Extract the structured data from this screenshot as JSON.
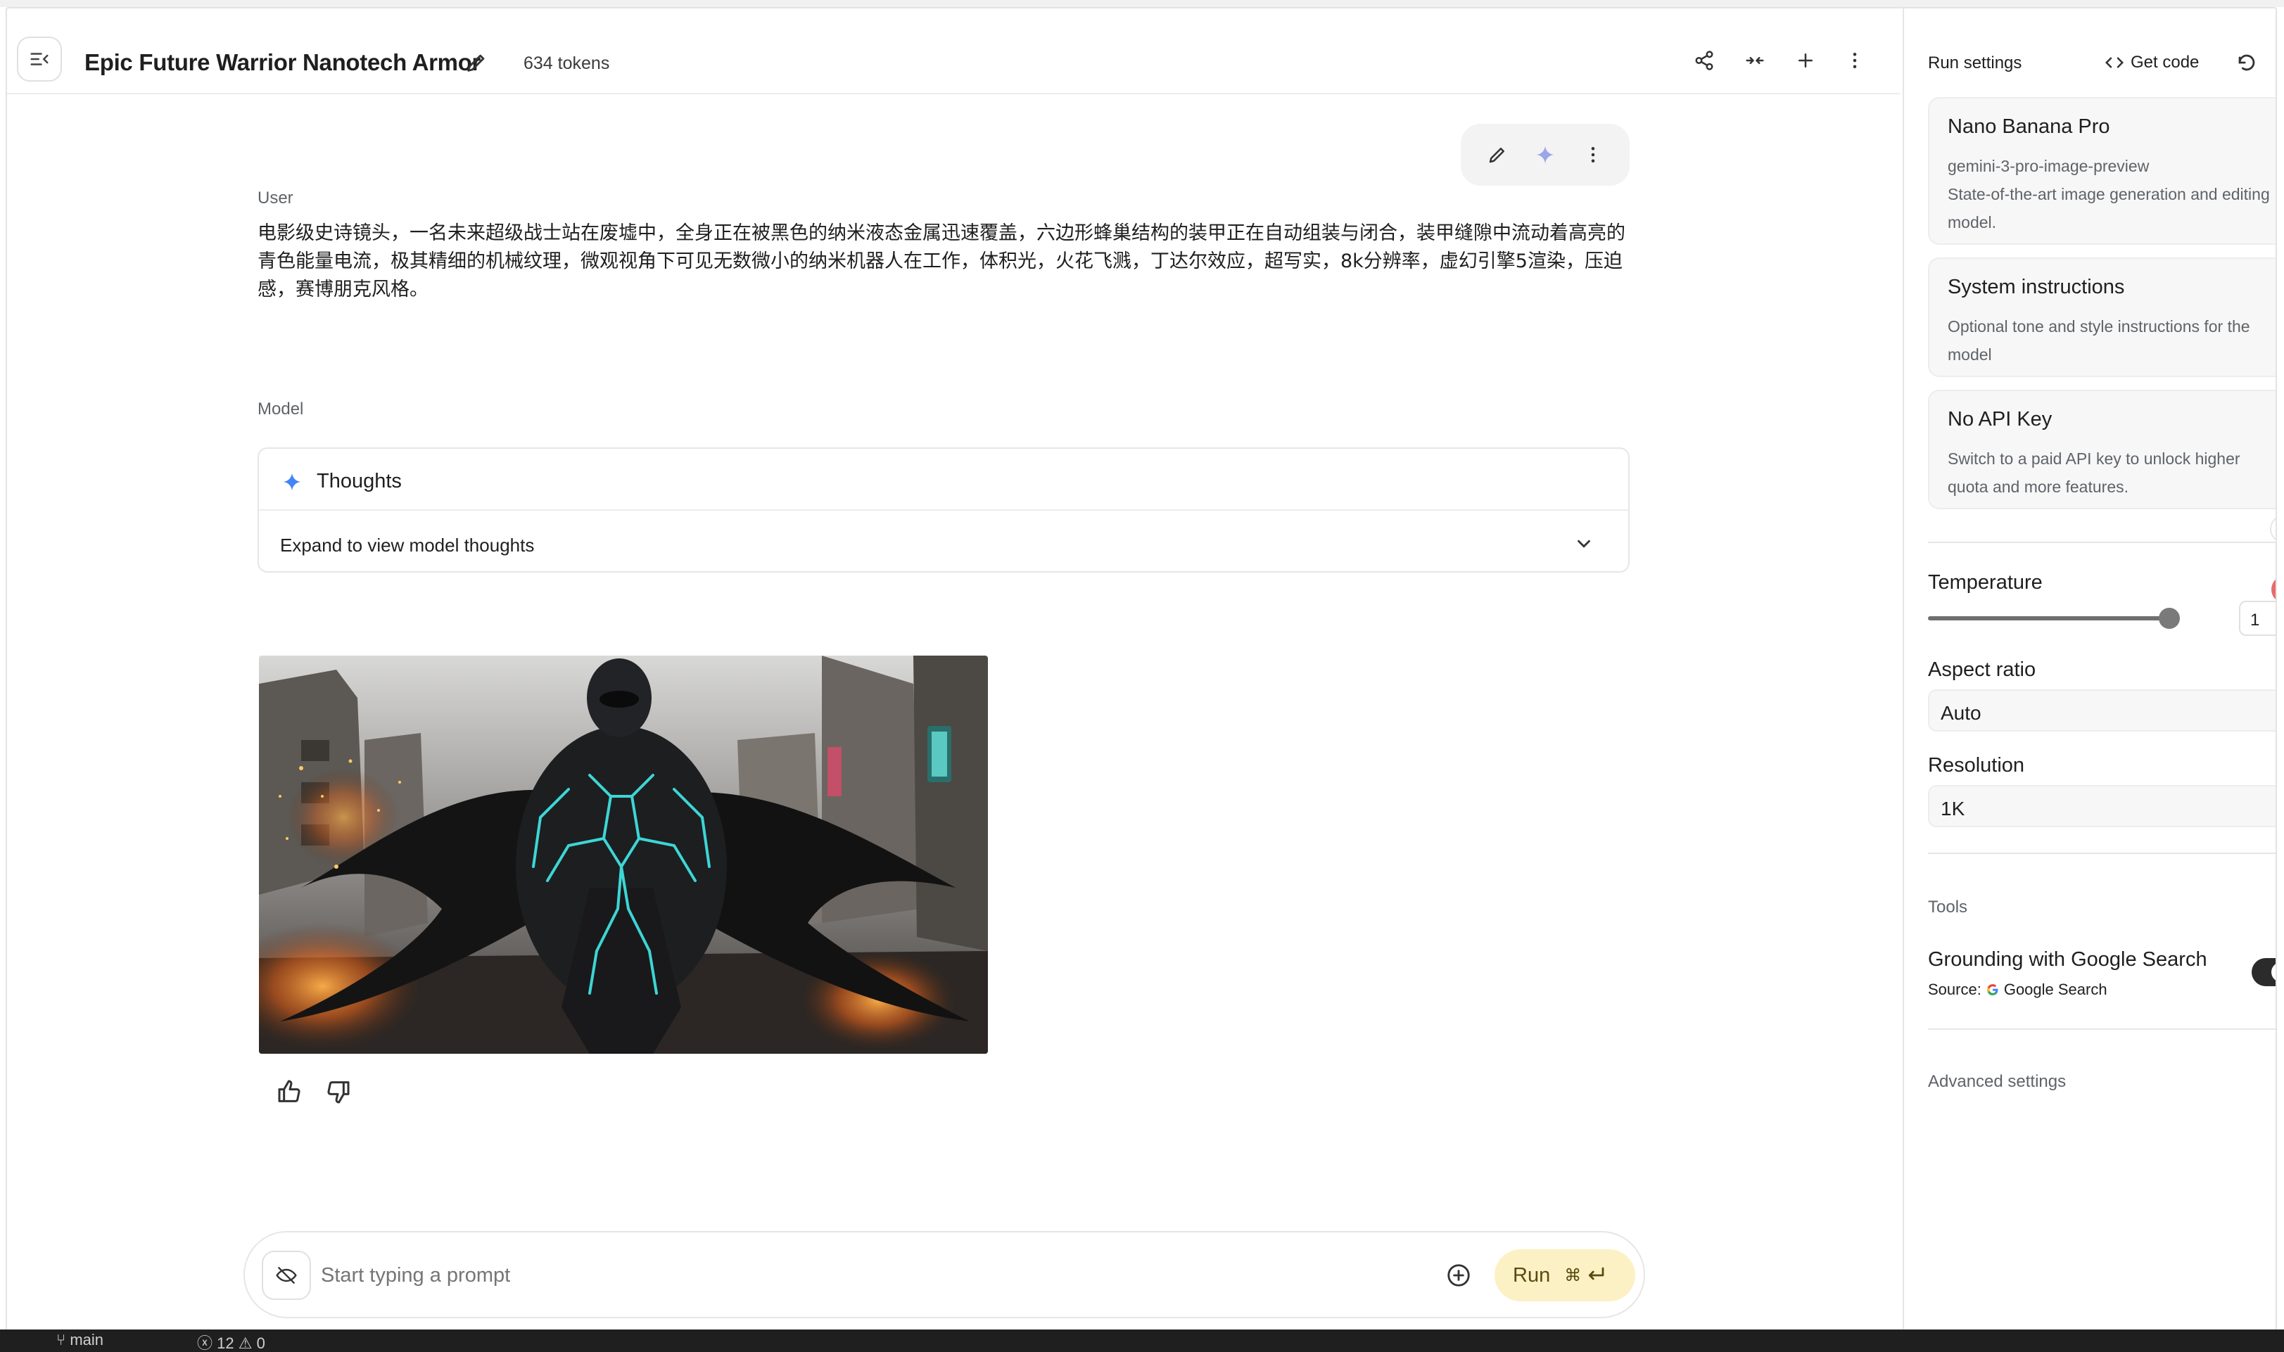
{
  "header": {
    "title": "Epic Future Warrior Nanotech Armor",
    "tokens": "634 tokens"
  },
  "conversation": {
    "user_label": "User",
    "user_text": "电影级史诗镜头，一名未来超级战士站在废墟中，全身正在被黑色的纳米液态金属迅速覆盖，六边形蜂巢结构的装甲正在自动组装与闭合，装甲缝隙中流动着高亮的青色能量电流，极其精细的机械纹理，微观视角下可见无数微小的纳米机器人在工作，体积光，火花飞溅，丁达尔效应，超写实，8k分辨率，虚幻引擎5渲染，压迫感，赛博朋克风格。",
    "model_label": "Model",
    "thoughts_title": "Thoughts",
    "thoughts_expand": "Expand to view model thoughts"
  },
  "prompt": {
    "placeholder": "Start typing a prompt",
    "run_label": "Run",
    "run_shortcut": "⌘"
  },
  "status_bar": {
    "branch": "main",
    "errors": "12",
    "warnings": "0"
  },
  "panel": {
    "title": "Run settings",
    "get_code": "Get code",
    "model_card": {
      "title": "Nano Banana Pro",
      "id": "gemini-3-pro-image-preview",
      "description": "State-of-the-art image generation and editing model."
    },
    "system_card": {
      "title": "System instructions",
      "description": "Optional tone and style instructions for the model"
    },
    "api_card": {
      "title": "No API Key",
      "description": "Switch to a paid API key to unlock higher quota and more features."
    },
    "temperature_label": "Temperature",
    "temperature_value": "1",
    "temperature_fraction": 0.5,
    "aspect_label": "Aspect ratio",
    "aspect_value": "Auto",
    "resolution_label": "Resolution",
    "resolution_value": "1K",
    "tools_label": "Tools",
    "grounding_title": "Grounding with Google Search",
    "grounding_source_label": "Source:",
    "grounding_source": "Google Search",
    "advanced_label": "Advanced settings"
  },
  "colors": {
    "run_bg": "#fbf1c4",
    "spark": "#4285f4",
    "energy": "#3fe0e0"
  }
}
